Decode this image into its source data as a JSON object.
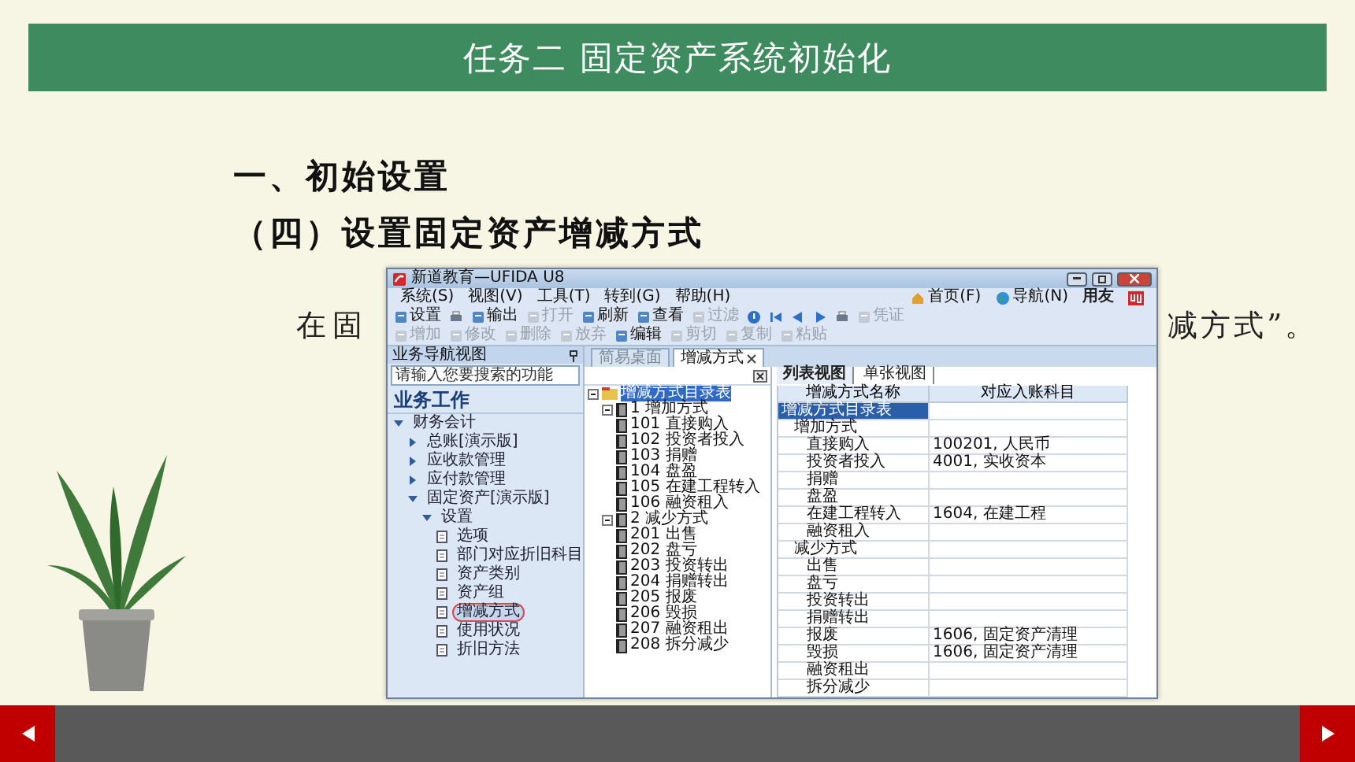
{
  "slide_title": "任务二 固定资产系统初始化",
  "heading": "一、初始设置",
  "subheading": "（四）设置固定资产增减方式",
  "paragraph_parts": [
    "在固",
    "减方式”。"
  ],
  "app": {
    "title": "新道教育—UFIDA U8",
    "menu": [
      "系统(S)",
      "视图(V)",
      "工具(T)",
      "转到(G)",
      "帮助(H)"
    ],
    "quick_links": [
      "首页(F)",
      "导航(N)"
    ],
    "brand": "用友",
    "toolbar_main": [
      {
        "kind": "button",
        "label": "设置",
        "disabled": false
      },
      {
        "kind": "icon",
        "disabled": false
      },
      {
        "kind": "button",
        "label": "输出",
        "disabled": false
      },
      {
        "kind": "button",
        "label": "打开",
        "disabled": true
      },
      {
        "kind": "button",
        "label": "刷新",
        "disabled": false
      },
      {
        "kind": "button",
        "label": "查看",
        "disabled": false
      },
      {
        "kind": "button",
        "label": "过滤",
        "disabled": true
      },
      {
        "kind": "icon",
        "disabled": false
      },
      {
        "kind": "icon",
        "disabled": false
      },
      {
        "kind": "icon",
        "disabled": false
      },
      {
        "kind": "icon",
        "disabled": false
      },
      {
        "kind": "icon",
        "disabled": false
      },
      {
        "kind": "button",
        "label": "凭证",
        "disabled": true
      }
    ],
    "toolbar_edit": [
      {
        "kind": "button",
        "label": "增加",
        "disabled": true
      },
      {
        "kind": "button",
        "label": "修改",
        "disabled": true
      },
      {
        "kind": "button",
        "label": "删除",
        "disabled": true
      },
      {
        "kind": "button",
        "label": "放弃",
        "disabled": true
      },
      {
        "kind": "button",
        "label": "编辑",
        "disabled": false
      },
      {
        "kind": "button",
        "label": "剪切",
        "disabled": true
      },
      {
        "kind": "button",
        "label": "复制",
        "disabled": true
      },
      {
        "kind": "button",
        "label": "粘贴",
        "disabled": true
      }
    ],
    "nav": {
      "title": "业务导航视图",
      "search": {
        "placeholder": "请输入您要搜索的功能"
      },
      "section": "业务工作",
      "items": [
        {
          "label": "财务会计",
          "selected": false,
          "expanded": true,
          "children": [
            {
              "label": "总账[演示版]",
              "selected": false,
              "expanded": false
            },
            {
              "label": "应收款管理",
              "selected": false,
              "expanded": false
            },
            {
              "label": "应付款管理",
              "selected": false,
              "expanded": false
            },
            {
              "label": "固定资产[演示版]",
              "selected": false,
              "expanded": true,
              "children": [
                {
                  "label": "设置",
                  "selected": false,
                  "expanded": true,
                  "children": [
                    {
                      "label": "选项",
                      "selected": false
                    },
                    {
                      "label": "部门对应折旧科目",
                      "selected": false
                    },
                    {
                      "label": "资产类别",
                      "selected": false
                    },
                    {
                      "label": "资产组",
                      "selected": false
                    },
                    {
                      "label": "增减方式",
                      "selected": true
                    },
                    {
                      "label": "使用状况",
                      "selected": false
                    },
                    {
                      "label": "折旧方法",
                      "selected": false
                    }
                  ]
                }
              ]
            }
          ]
        }
      ]
    },
    "tabs": [
      {
        "label": "简易桌面",
        "selected": false
      },
      {
        "label": "增减方式",
        "selected": true
      }
    ],
    "tree": [
      {
        "label": "增减方式目录表",
        "selected": true,
        "expanded": true,
        "children": [
          {
            "label": "1 增加方式",
            "selected": false,
            "expanded": true,
            "children": [
              {
                "label": "101 直接购入",
                "selected": false
              },
              {
                "label": "102 投资者投入",
                "selected": false
              },
              {
                "label": "103 捐赠",
                "selected": false
              },
              {
                "label": "104 盘盈",
                "selected": false
              },
              {
                "label": "105 在建工程转入",
                "selected": false
              },
              {
                "label": "106 融资租入",
                "selected": false
              }
            ]
          },
          {
            "label": "2 减少方式",
            "selected": false,
            "expanded": true,
            "children": [
              {
                "label": "201 出售",
                "selected": false
              },
              {
                "label": "202 盘亏",
                "selected": false
              },
              {
                "label": "203 投资转出",
                "selected": false
              },
              {
                "label": "204 捐赠转出",
                "selected": false
              },
              {
                "label": "205 报废",
                "selected": false
              },
              {
                "label": "206 毁损",
                "selected": false
              },
              {
                "label": "207 融资租出",
                "selected": false
              },
              {
                "label": "208 拆分减少",
                "selected": false
              }
            ]
          }
        ]
      }
    ],
    "view_tabs": [
      {
        "label": "列表视图",
        "selected": true
      },
      {
        "label": "单张视图",
        "selected": false
      }
    ],
    "table": {
      "columns": [
        "增减方式名称",
        "对应入账科目"
      ],
      "rows": [
        {
          "name": "增减方式目录表",
          "selected": true,
          "children": [
            {
              "name": "增加方式",
              "selected": false,
              "children": [
                {
                  "name": "直接购入",
                  "account": "100201, 人民币",
                  "selected": false
                },
                {
                  "name": "投资者投入",
                  "account": "4001, 实收资本",
                  "selected": false
                },
                {
                  "name": "捐赠",
                  "selected": false
                },
                {
                  "name": "盘盈",
                  "selected": false
                },
                {
                  "name": "在建工程转入",
                  "account": "1604, 在建工程",
                  "selected": false
                },
                {
                  "name": "融资租入",
                  "selected": false
                }
              ]
            },
            {
              "name": "减少方式",
              "selected": false,
              "children": [
                {
                  "name": "出售",
                  "selected": false
                },
                {
                  "name": "盘亏",
                  "selected": false
                },
                {
                  "name": "投资转出",
                  "selected": false
                },
                {
                  "name": "捐赠转出",
                  "selected": false
                },
                {
                  "name": "报废",
                  "account": "1606, 固定资产清理",
                  "selected": false
                },
                {
                  "name": "毁损",
                  "account": "1606, 固定资产清理",
                  "selected": false
                },
                {
                  "name": "融资租出",
                  "selected": false
                },
                {
                  "name": "拆分减少",
                  "selected": false
                }
              ]
            }
          ]
        }
      ]
    }
  }
}
